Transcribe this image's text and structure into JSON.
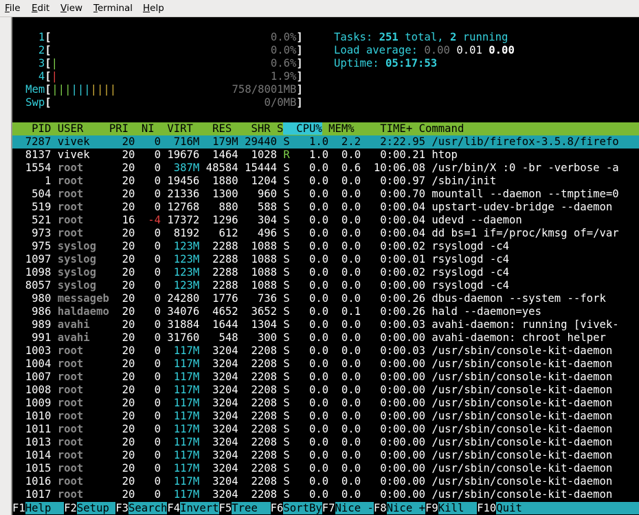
{
  "menubar": [
    {
      "label": "File",
      "mnemonic": "F",
      "rest": "ile"
    },
    {
      "label": "Edit",
      "mnemonic": "E",
      "rest": "dit"
    },
    {
      "label": "View",
      "mnemonic": "V",
      "rest": "iew"
    },
    {
      "label": "Terminal",
      "mnemonic": "T",
      "rest": "erminal"
    },
    {
      "label": "Help",
      "mnemonic": "H",
      "rest": "elp"
    }
  ],
  "meters": [
    {
      "label": "1",
      "bar": "",
      "value": "0.0%"
    },
    {
      "label": "2",
      "bar": "",
      "value": "0.0%"
    },
    {
      "label": "3",
      "bar": "|",
      "value": "0.6%"
    },
    {
      "label": "4",
      "bar": "|",
      "value": "1.9%"
    },
    {
      "label": "Mem",
      "bar": "||||||||||",
      "value": "758/8001MB"
    },
    {
      "label": "Swp",
      "bar": "",
      "value": "0/0MB"
    }
  ],
  "summary": {
    "tasks_label": "Tasks: ",
    "tasks_total": "251",
    "tasks_total_label": " total, ",
    "tasks_running": "2",
    "tasks_running_label": " running",
    "load_label": "Load average: ",
    "load_1": "0.00",
    "load_5": "0.01",
    "load_15": "0.00",
    "uptime_label": "Uptime: ",
    "uptime": "05:17:53"
  },
  "columns": [
    "PID",
    "USER",
    "PRI",
    "NI",
    "VIRT",
    "RES",
    "SHR",
    "S",
    "CPU%",
    "MEM%",
    "TIME+",
    "Command"
  ],
  "sort_column": "CPU%",
  "processes": [
    {
      "pid": "7287",
      "user": "vivek",
      "pri": "20",
      "ni": "0",
      "virt": "716M",
      "res": "179M",
      "shr": "29440",
      "s": "S",
      "cpu": "1.0",
      "mem": "2.2",
      "time": "2:22.95",
      "cmd": "/usr/lib/firefox-3.5.8/firefo",
      "selected": true
    },
    {
      "pid": "8137",
      "user": "vivek",
      "pri": "20",
      "ni": "0",
      "virt": "19676",
      "res": "1464",
      "shr": "1028",
      "s": "R",
      "cpu": "1.0",
      "mem": "0.0",
      "time": "0:00.21",
      "cmd": "htop"
    },
    {
      "pid": "1554",
      "user": "root",
      "pri": "20",
      "ni": "0",
      "virt": "387M",
      "res": "48584",
      "shr": "15444",
      "s": "S",
      "cpu": "0.0",
      "mem": "0.6",
      "time": "10:06.08",
      "cmd": "/usr/bin/X :0 -br -verbose -a"
    },
    {
      "pid": "1",
      "user": "root",
      "pri": "20",
      "ni": "0",
      "virt": "19456",
      "res": "1880",
      "shr": "1204",
      "s": "S",
      "cpu": "0.0",
      "mem": "0.0",
      "time": "0:00.97",
      "cmd": "/sbin/init"
    },
    {
      "pid": "504",
      "user": "root",
      "pri": "20",
      "ni": "0",
      "virt": "21336",
      "res": "1300",
      "shr": "960",
      "s": "S",
      "cpu": "0.0",
      "mem": "0.0",
      "time": "0:00.70",
      "cmd": "mountall --daemon --tmptime=0"
    },
    {
      "pid": "519",
      "user": "root",
      "pri": "20",
      "ni": "0",
      "virt": "12768",
      "res": "880",
      "shr": "588",
      "s": "S",
      "cpu": "0.0",
      "mem": "0.0",
      "time": "0:00.04",
      "cmd": "upstart-udev-bridge --daemon"
    },
    {
      "pid": "521",
      "user": "root",
      "pri": "16",
      "ni": "-4",
      "virt": "17372",
      "res": "1296",
      "shr": "304",
      "s": "S",
      "cpu": "0.0",
      "mem": "0.0",
      "time": "0:00.04",
      "cmd": "udevd --daemon"
    },
    {
      "pid": "973",
      "user": "root",
      "pri": "20",
      "ni": "0",
      "virt": "8192",
      "res": "612",
      "shr": "496",
      "s": "S",
      "cpu": "0.0",
      "mem": "0.0",
      "time": "0:00.04",
      "cmd": "dd bs=1 if=/proc/kmsg of=/var"
    },
    {
      "pid": "975",
      "user": "syslog",
      "pri": "20",
      "ni": "0",
      "virt": "123M",
      "res": "2288",
      "shr": "1088",
      "s": "S",
      "cpu": "0.0",
      "mem": "0.0",
      "time": "0:00.02",
      "cmd": "rsyslogd -c4"
    },
    {
      "pid": "1097",
      "user": "syslog",
      "pri": "20",
      "ni": "0",
      "virt": "123M",
      "res": "2288",
      "shr": "1088",
      "s": "S",
      "cpu": "0.0",
      "mem": "0.0",
      "time": "0:00.01",
      "cmd": "rsyslogd -c4"
    },
    {
      "pid": "1098",
      "user": "syslog",
      "pri": "20",
      "ni": "0",
      "virt": "123M",
      "res": "2288",
      "shr": "1088",
      "s": "S",
      "cpu": "0.0",
      "mem": "0.0",
      "time": "0:00.02",
      "cmd": "rsyslogd -c4"
    },
    {
      "pid": "8057",
      "user": "syslog",
      "pri": "20",
      "ni": "0",
      "virt": "123M",
      "res": "2288",
      "shr": "1088",
      "s": "S",
      "cpu": "0.0",
      "mem": "0.0",
      "time": "0:00.00",
      "cmd": "rsyslogd -c4"
    },
    {
      "pid": "980",
      "user": "messageb",
      "pri": "20",
      "ni": "0",
      "virt": "24280",
      "res": "1776",
      "shr": "736",
      "s": "S",
      "cpu": "0.0",
      "mem": "0.0",
      "time": "0:00.26",
      "cmd": "dbus-daemon --system --fork"
    },
    {
      "pid": "986",
      "user": "haldaemo",
      "pri": "20",
      "ni": "0",
      "virt": "34076",
      "res": "4652",
      "shr": "3652",
      "s": "S",
      "cpu": "0.0",
      "mem": "0.1",
      "time": "0:00.26",
      "cmd": "hald --daemon=yes"
    },
    {
      "pid": "989",
      "user": "avahi",
      "pri": "20",
      "ni": "0",
      "virt": "31884",
      "res": "1644",
      "shr": "1304",
      "s": "S",
      "cpu": "0.0",
      "mem": "0.0",
      "time": "0:00.03",
      "cmd": "avahi-daemon: running [vivek-"
    },
    {
      "pid": "991",
      "user": "avahi",
      "pri": "20",
      "ni": "0",
      "virt": "31760",
      "res": "548",
      "shr": "300",
      "s": "S",
      "cpu": "0.0",
      "mem": "0.0",
      "time": "0:00.00",
      "cmd": "avahi-daemon: chroot helper"
    },
    {
      "pid": "1003",
      "user": "root",
      "pri": "20",
      "ni": "0",
      "virt": "117M",
      "res": "3204",
      "shr": "2208",
      "s": "S",
      "cpu": "0.0",
      "mem": "0.0",
      "time": "0:00.03",
      "cmd": "/usr/sbin/console-kit-daemon"
    },
    {
      "pid": "1004",
      "user": "root",
      "pri": "20",
      "ni": "0",
      "virt": "117M",
      "res": "3204",
      "shr": "2208",
      "s": "S",
      "cpu": "0.0",
      "mem": "0.0",
      "time": "0:00.00",
      "cmd": "/usr/sbin/console-kit-daemon"
    },
    {
      "pid": "1007",
      "user": "root",
      "pri": "20",
      "ni": "0",
      "virt": "117M",
      "res": "3204",
      "shr": "2208",
      "s": "S",
      "cpu": "0.0",
      "mem": "0.0",
      "time": "0:00.00",
      "cmd": "/usr/sbin/console-kit-daemon"
    },
    {
      "pid": "1008",
      "user": "root",
      "pri": "20",
      "ni": "0",
      "virt": "117M",
      "res": "3204",
      "shr": "2208",
      "s": "S",
      "cpu": "0.0",
      "mem": "0.0",
      "time": "0:00.00",
      "cmd": "/usr/sbin/console-kit-daemon"
    },
    {
      "pid": "1009",
      "user": "root",
      "pri": "20",
      "ni": "0",
      "virt": "117M",
      "res": "3204",
      "shr": "2208",
      "s": "S",
      "cpu": "0.0",
      "mem": "0.0",
      "time": "0:00.00",
      "cmd": "/usr/sbin/console-kit-daemon"
    },
    {
      "pid": "1010",
      "user": "root",
      "pri": "20",
      "ni": "0",
      "virt": "117M",
      "res": "3204",
      "shr": "2208",
      "s": "S",
      "cpu": "0.0",
      "mem": "0.0",
      "time": "0:00.00",
      "cmd": "/usr/sbin/console-kit-daemon"
    },
    {
      "pid": "1011",
      "user": "root",
      "pri": "20",
      "ni": "0",
      "virt": "117M",
      "res": "3204",
      "shr": "2208",
      "s": "S",
      "cpu": "0.0",
      "mem": "0.0",
      "time": "0:00.00",
      "cmd": "/usr/sbin/console-kit-daemon"
    },
    {
      "pid": "1013",
      "user": "root",
      "pri": "20",
      "ni": "0",
      "virt": "117M",
      "res": "3204",
      "shr": "2208",
      "s": "S",
      "cpu": "0.0",
      "mem": "0.0",
      "time": "0:00.00",
      "cmd": "/usr/sbin/console-kit-daemon"
    },
    {
      "pid": "1014",
      "user": "root",
      "pri": "20",
      "ni": "0",
      "virt": "117M",
      "res": "3204",
      "shr": "2208",
      "s": "S",
      "cpu": "0.0",
      "mem": "0.0",
      "time": "0:00.00",
      "cmd": "/usr/sbin/console-kit-daemon"
    },
    {
      "pid": "1015",
      "user": "root",
      "pri": "20",
      "ni": "0",
      "virt": "117M",
      "res": "3204",
      "shr": "2208",
      "s": "S",
      "cpu": "0.0",
      "mem": "0.0",
      "time": "0:00.00",
      "cmd": "/usr/sbin/console-kit-daemon"
    },
    {
      "pid": "1016",
      "user": "root",
      "pri": "20",
      "ni": "0",
      "virt": "117M",
      "res": "3204",
      "shr": "2208",
      "s": "S",
      "cpu": "0.0",
      "mem": "0.0",
      "time": "0:00.00",
      "cmd": "/usr/sbin/console-kit-daemon"
    },
    {
      "pid": "1017",
      "user": "root",
      "pri": "20",
      "ni": "0",
      "virt": "117M",
      "res": "3204",
      "shr": "2208",
      "s": "S",
      "cpu": "0.0",
      "mem": "0.0",
      "time": "0:00.00",
      "cmd": "/usr/sbin/console-kit-daemon"
    }
  ],
  "function_keys": [
    {
      "key": "F1",
      "label": "Help  "
    },
    {
      "key": "F2",
      "label": "Setup "
    },
    {
      "key": "F3",
      "label": "Search"
    },
    {
      "key": "F4",
      "label": "Invert"
    },
    {
      "key": "F5",
      "label": "Tree  "
    },
    {
      "key": "F6",
      "label": "SortBy"
    },
    {
      "key": "F7",
      "label": "Nice -"
    },
    {
      "key": "F8",
      "label": "Nice +"
    },
    {
      "key": "F9",
      "label": "Kill  "
    },
    {
      "key": "F10",
      "label": "Quit"
    }
  ],
  "colors": {
    "header_bg": "#7ab934",
    "sort_col_bg": "#34c6d4",
    "selected_row_bg": "#1fa0ad",
    "cyan": "#34d0dc",
    "green": "#7fd14b",
    "red": "#e34040",
    "function_label_bg": "#27a9b6"
  }
}
